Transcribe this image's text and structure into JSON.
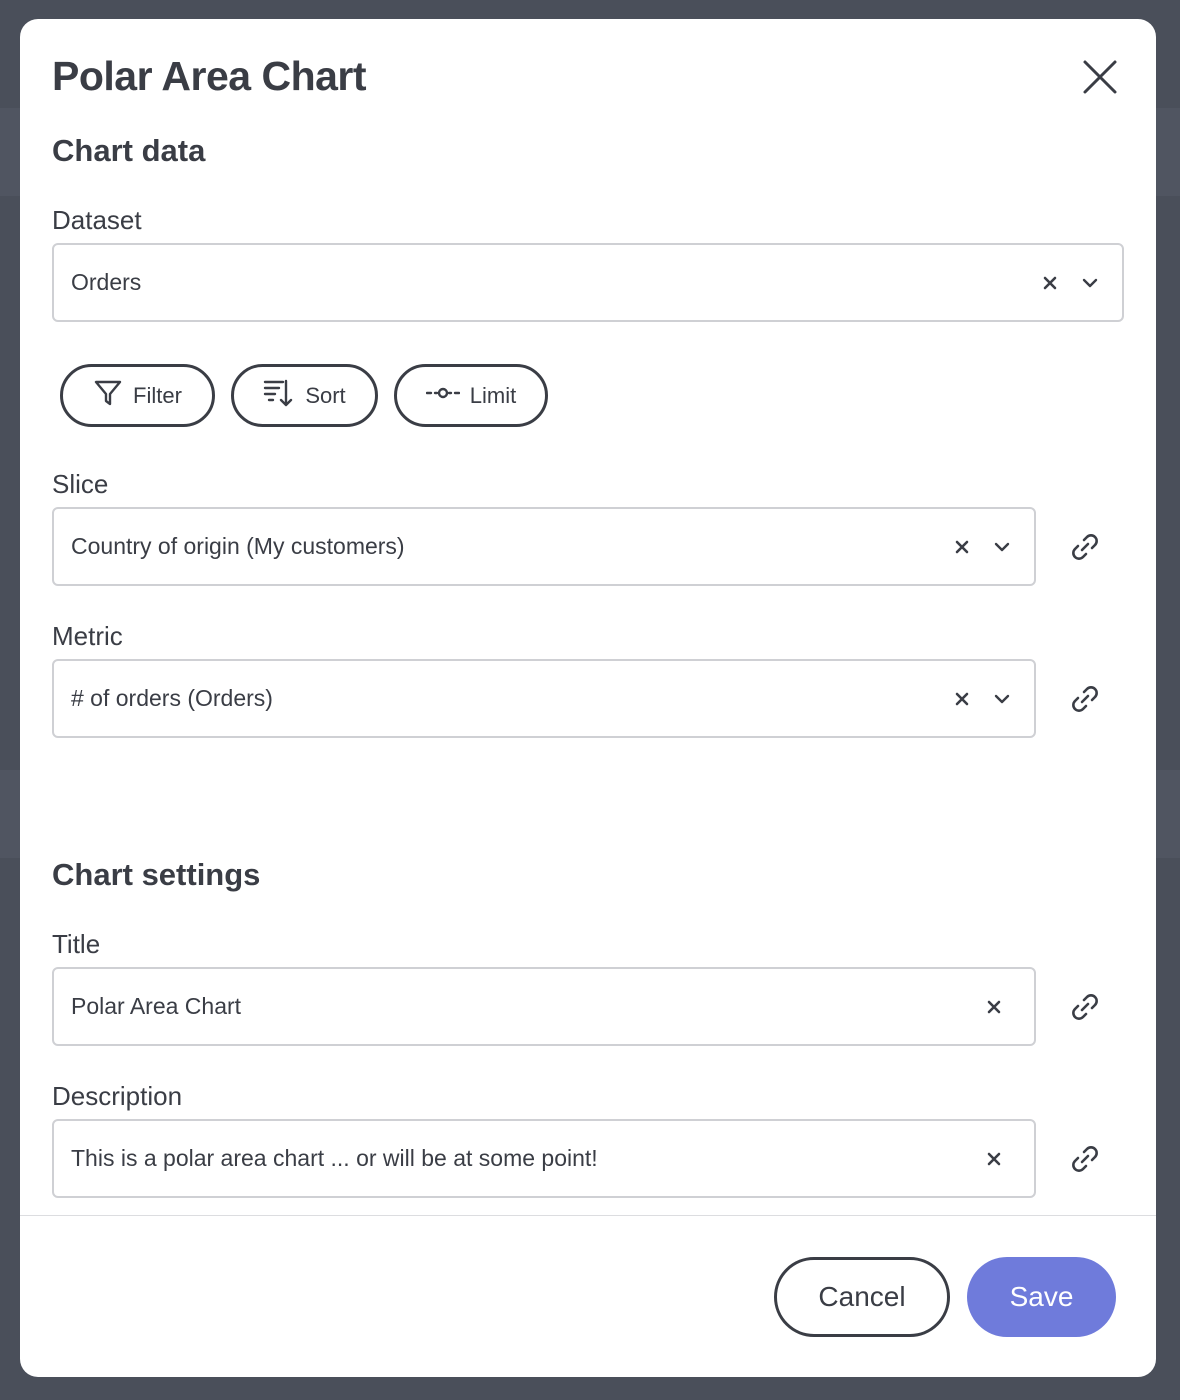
{
  "modal": {
    "title": "Polar Area Chart"
  },
  "chart_data_section": {
    "heading": "Chart data",
    "dataset": {
      "label": "Dataset",
      "value": "Orders"
    },
    "actions": [
      {
        "label": "Filter",
        "icon": "filter-icon"
      },
      {
        "label": "Sort",
        "icon": "sort-icon"
      },
      {
        "label": "Limit",
        "icon": "limit-icon"
      }
    ],
    "slice": {
      "label": "Slice",
      "value": "Country of origin (My customers)"
    },
    "metric": {
      "label": "Metric",
      "value": "# of orders (Orders)"
    }
  },
  "chart_settings_section": {
    "heading": "Chart settings",
    "title_field": {
      "label": "Title",
      "value": "Polar Area Chart"
    },
    "description_field": {
      "label": "Description",
      "value": "This is a polar area chart ... or will be at some point!"
    }
  },
  "footer": {
    "cancel_label": "Cancel",
    "save_label": "Save"
  },
  "colors": {
    "text": "#3a3d45",
    "primary": "#6f7bdb",
    "border": "#cfd0d4",
    "backdrop": "#4a4f5a"
  }
}
